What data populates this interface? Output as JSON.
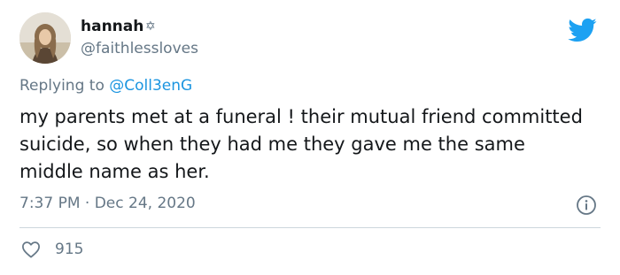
{
  "tweet": {
    "author": {
      "display_name": "hannah",
      "name_emoji": "✡",
      "handle": "@faithlessloves"
    },
    "reply": {
      "prefix": "Replying to",
      "target": "@Coll3enG"
    },
    "text": "my parents met at a funeral ! their mutual friend committed suicide, so when they had me they gave me the same middle name as her.",
    "timestamp": "7:37 PM · Dec 24, 2020",
    "likes": "915"
  },
  "icons": {
    "brand": "twitter-bird-icon",
    "info": "info-icon",
    "like": "heart-icon"
  },
  "colors": {
    "brand_blue": "#1da1f2",
    "link_blue": "#1b95e0",
    "secondary_text": "#657786",
    "primary_text": "#14171a",
    "divider": "#ccd6dd"
  }
}
